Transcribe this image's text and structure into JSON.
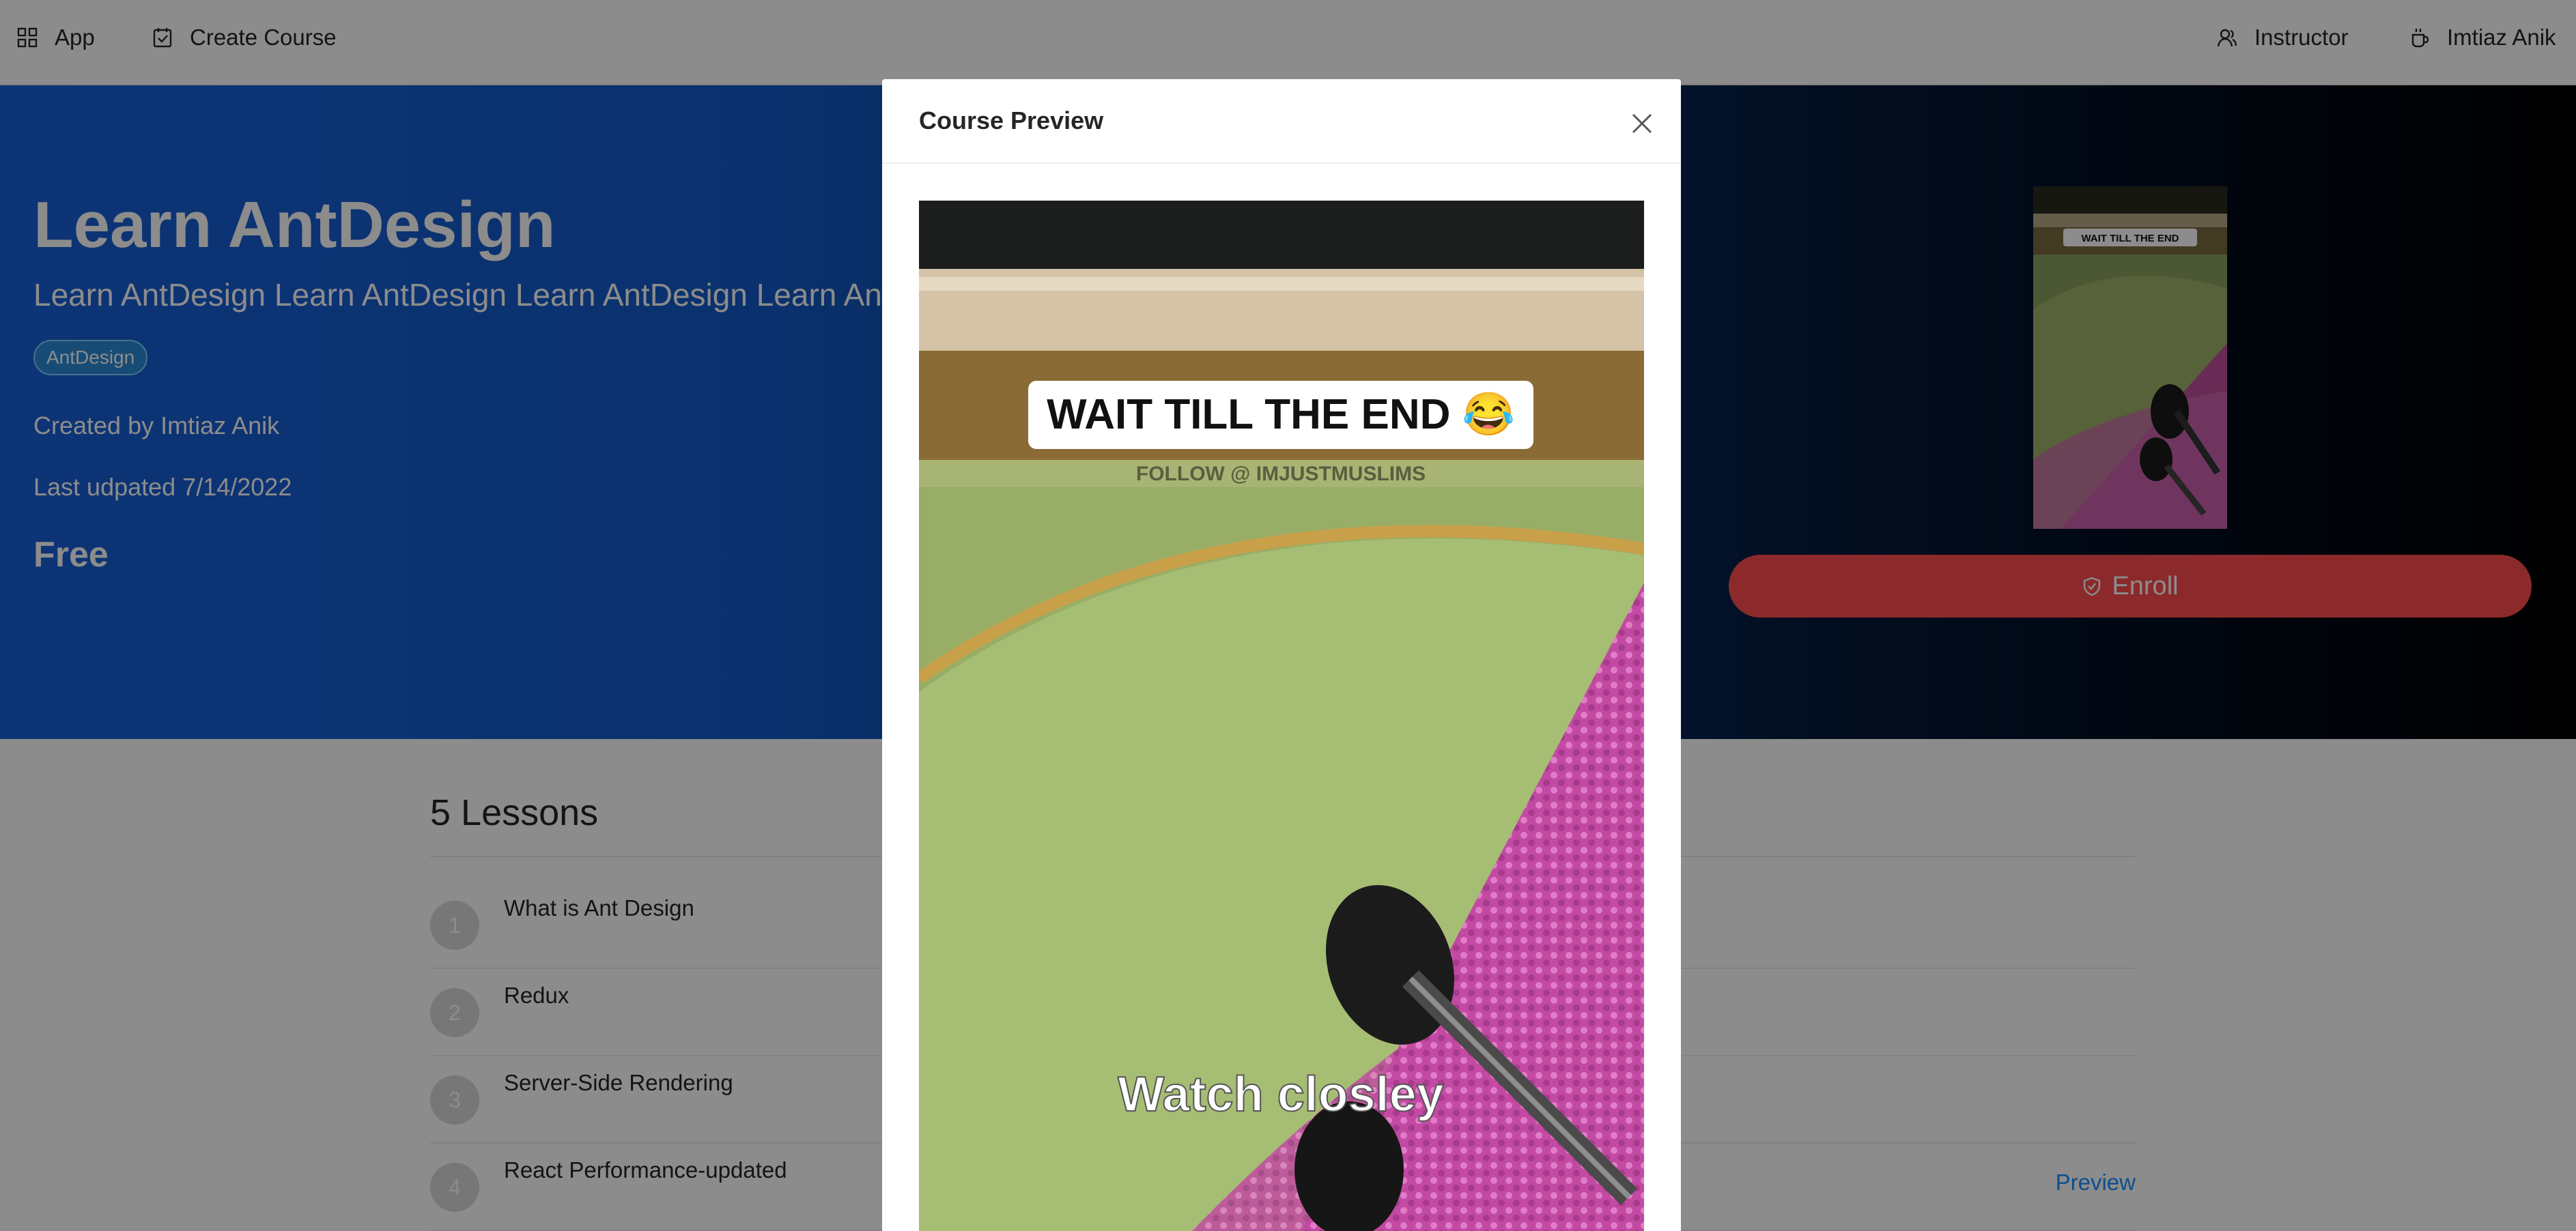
{
  "nav": {
    "app_label": "App",
    "create_course_label": "Create Course",
    "instructor_label": "Instructor",
    "user_label": "Imtiaz Anik"
  },
  "course": {
    "title": "Learn AntDesign",
    "description": "Learn AntDesign Learn AntDesign Learn AntDesign Learn AntDesign",
    "tag": "AntDesign",
    "created_by": "Created by Imtiaz Anik",
    "last_updated": "Last udpated 7/14/2022",
    "price": "Free",
    "enroll_label": "Enroll"
  },
  "video": {
    "caption_top": "WAIT TILL THE END 😂",
    "caption_sub": "FOLLOW @ IMJUSTMUSLIMS",
    "caption_bottom": "Watch closley"
  },
  "lessons": {
    "heading": "5 Lessons",
    "items": [
      {
        "number": "1",
        "title": "What is Ant Design"
      },
      {
        "number": "2",
        "title": "Redux"
      },
      {
        "number": "3",
        "title": "Server-Side Rendering"
      },
      {
        "number": "4",
        "title": "React Performance-updated",
        "preview": "Preview"
      }
    ]
  },
  "modal": {
    "title": "Course Preview"
  },
  "colors": {
    "enroll_button": "#ff4d4f",
    "preview_link": "#1890ff",
    "hero_gradient_start": "#1860d8",
    "hero_gradient_end": "#000000"
  },
  "icons": {
    "app": "appstore-icon",
    "create_course": "carry-out-icon",
    "instructor": "team-icon",
    "user": "coffee-icon",
    "enroll": "safety-icon",
    "close": "close-icon"
  }
}
